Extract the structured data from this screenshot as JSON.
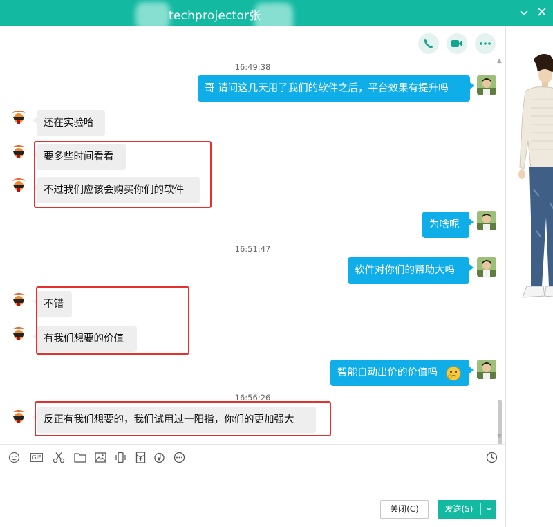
{
  "title": {
    "contact_name": "techprojector张"
  },
  "messages": [
    {
      "type": "timestamp",
      "text": "16:49:38"
    },
    {
      "type": "out",
      "text": "哥 请问这几天用了我们的软件之后，平台效果有提升吗"
    },
    {
      "type": "in",
      "text": "还在实验哈"
    },
    {
      "type": "in",
      "text": "要多些时间看看"
    },
    {
      "type": "in",
      "text": "不过我们应该会购买你们的软件"
    },
    {
      "type": "out",
      "text": "为啥呢"
    },
    {
      "type": "timestamp",
      "text": "16:51:47"
    },
    {
      "type": "out",
      "text": "软件对你们的帮助大吗"
    },
    {
      "type": "in",
      "text": "不错"
    },
    {
      "type": "in",
      "text": "有我们想要的价值"
    },
    {
      "type": "out",
      "text": "智能自动出价的价值吗",
      "emoji": "thinking-face"
    },
    {
      "type": "timestamp",
      "text": "16:56:26"
    },
    {
      "type": "in",
      "text": "反正有我们想要的，我们试用过一阳指，你们的更加强大"
    }
  ],
  "header_actions": [
    "phone-call",
    "video-call",
    "more"
  ],
  "toolbar": {
    "gif_label": "GIF",
    "icons": [
      "emoji",
      "gif",
      "screenshot-scissors",
      "folder",
      "image",
      "shake",
      "red-packet",
      "music",
      "more",
      "history-clock"
    ]
  },
  "buttons": {
    "close_label": "关闭(C)",
    "send_label": "发送(S)"
  },
  "colors": {
    "titlebar": "#13b9a1",
    "outgoing_bubble": "#10aee8",
    "incoming_bubble": "#eeeeee",
    "highlight_box": "#e53030"
  }
}
